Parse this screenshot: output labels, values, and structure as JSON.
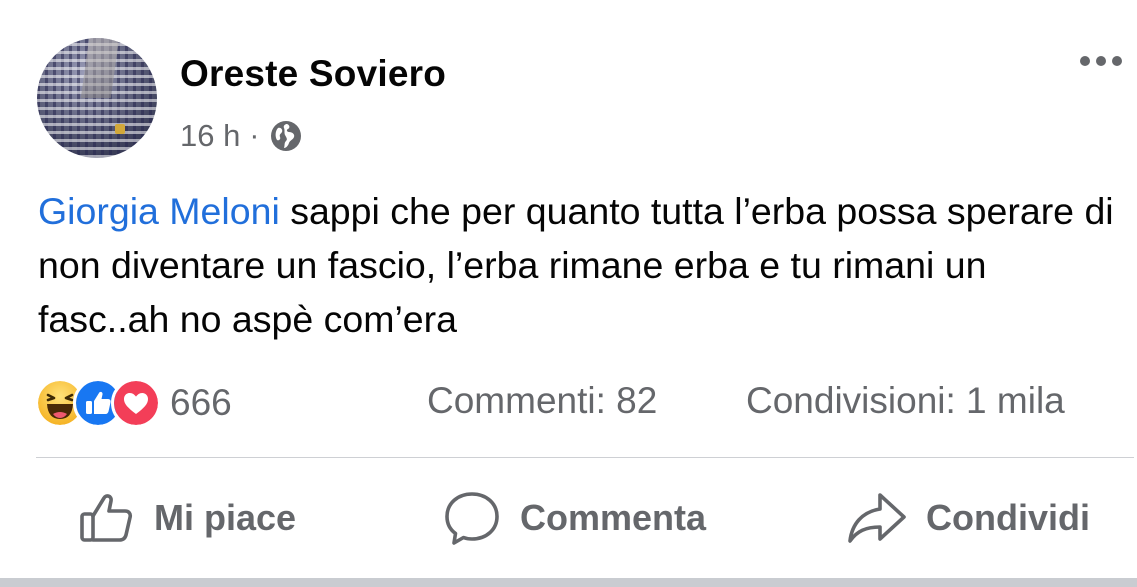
{
  "post": {
    "author": "Oreste Soviero",
    "time": "16 h",
    "separator": "·",
    "privacy_icon": "globe-icon",
    "more_icon": "more-horizontal-icon",
    "mention": "Giorgia Meloni",
    "text": " sappi che per quanto tutta l’erba possa sperare di non diventare un fascio, l’erba rimane erba e tu rimani un fasc..ah no aspè com’era"
  },
  "stats": {
    "reaction_icons": [
      "haha-reaction-icon",
      "like-reaction-icon",
      "love-reaction-icon"
    ],
    "reactions_count": "666",
    "comments": "Commenti: 82",
    "shares": "Condivisioni: 1 mila"
  },
  "actions": {
    "like": "Mi piace",
    "comment": "Commenta",
    "share": "Condividi"
  },
  "colors": {
    "mention": "#216fdb",
    "secondary_text": "#65676b",
    "like_blue": "#1877f2",
    "love_red": "#f33e58",
    "haha_yellow": "#f7c02a"
  }
}
